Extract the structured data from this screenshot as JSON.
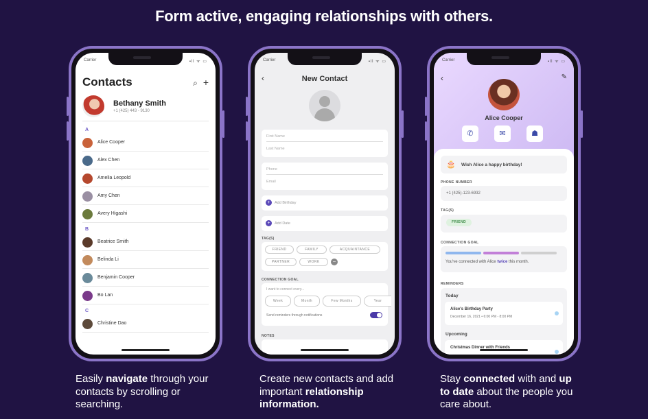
{
  "headline": "Form active, engaging relationships with others.",
  "status": {
    "carrier": "Carrier",
    "indicators": "▪ll ᯤ ▭"
  },
  "phone1": {
    "title": "Contacts",
    "me": {
      "name": "Bethany Smith",
      "phone": "+1 (425) 443 - 9130"
    },
    "sections": [
      {
        "letter": "A",
        "contacts": [
          "Alice Cooper",
          "Alex Chen",
          "Amelia Leopold",
          "Amy Chen",
          "Avery Higashi"
        ]
      },
      {
        "letter": "B",
        "contacts": [
          "Beatrice Smith",
          "Belinda Li",
          "Benjamin Cooper",
          "Bo Lan"
        ]
      },
      {
        "letter": "C",
        "contacts": [
          "Christine Dao"
        ]
      }
    ]
  },
  "phone2": {
    "title": "New Contact",
    "first_name": "First Name",
    "last_name": "Last Name",
    "phone": "Phone",
    "email": "Email",
    "add_birthday": "Add Birthday",
    "add_date": "Add Date",
    "tags_label": "TAG(S)",
    "tags": [
      "FRIEND",
      "FAMILY",
      "ACQUAINTANCE",
      "PARTNER",
      "WORK"
    ],
    "goal_label": "CONNECTION GOAL",
    "goal_prompt": "I want to connect every...",
    "goal_options": [
      "Week",
      "Month",
      "Few Months",
      "Year"
    ],
    "reminder_text": "Send reminders through notifications",
    "notes_label": "NOTES"
  },
  "phone3": {
    "name": "Alice Cooper",
    "birthday_text": "Wish Alice a happy birthday!",
    "phone_label": "PHONE NUMBER",
    "phone_value": "+1 (425)-123-6932",
    "tags_label": "TAG(S)",
    "tag": "FRIEND",
    "goal_label": "CONNECTION GOAL",
    "goal_pre": "You've connected with Alice ",
    "goal_em": "twice",
    "goal_post": " this month.",
    "reminders_label": "REMINDERS",
    "today_label": "Today",
    "event_title": "Alice's Birthday Party",
    "event_time": "December 16, 2021 • 6:00 PM - 8:00 PM",
    "upcoming_label": "Upcoming",
    "upcoming_event": "Christmas Dinner with Friends"
  },
  "captions": {
    "c1": {
      "pre": "Easily ",
      "b1": "navigate",
      "post": " through your contacts by scrolling or searching."
    },
    "c2": {
      "pre": "Create new contacts and add important ",
      "b1": "relationship information."
    },
    "c3": {
      "pre": "Stay ",
      "b1": "connected",
      "mid": " with and ",
      "b2": "up to date",
      "post": " about the people you care about."
    }
  },
  "colors": {
    "background": "#201343",
    "phone_frame": "#8b74c8",
    "accent": "#5a48b8"
  }
}
